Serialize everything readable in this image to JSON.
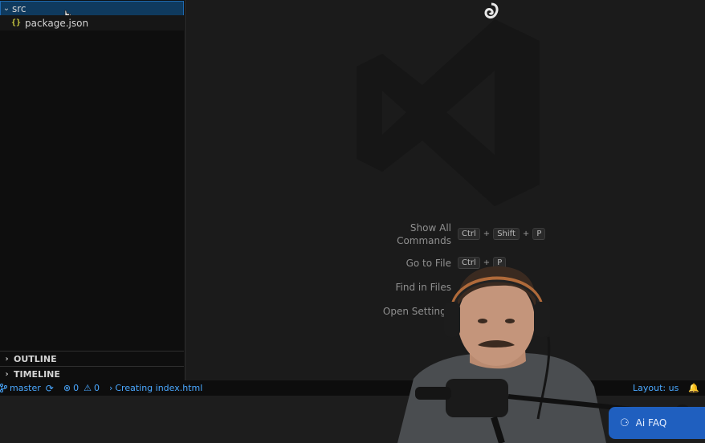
{
  "explorer": {
    "folder": {
      "label": "src",
      "icon": "chevron-down-icon"
    },
    "file": {
      "label": "package.json",
      "icon": "json-braces-icon",
      "icon_glyph": "{}"
    }
  },
  "panels": {
    "outline": "OUTLINE",
    "timeline": "TIMELINE"
  },
  "shortcuts": [
    {
      "label_line1": "Show All",
      "label_line2": "Commands",
      "keys": [
        "Ctrl",
        "+",
        "Shift",
        "+",
        "P"
      ]
    },
    {
      "label": "Go to File",
      "keys": [
        "Ctrl",
        "+",
        "P"
      ]
    },
    {
      "label": "Find in Files",
      "keys": []
    },
    {
      "label": "Open Settings",
      "keys": []
    }
  ],
  "statusbar": {
    "branch": "master",
    "errors": "0",
    "warnings": "0",
    "task": "Creating index.html",
    "layout": "Layout: us"
  },
  "overlay": {
    "badge_text": "Ai FAQ"
  },
  "colors": {
    "accent": "#4aa8ff",
    "selection_border": "#1f6ab0",
    "selection_bg": "#0f3a5e"
  }
}
